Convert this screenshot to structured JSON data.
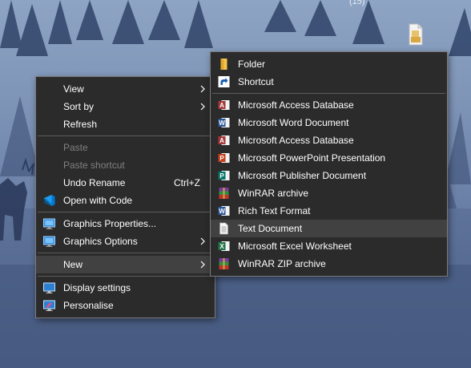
{
  "desktop": {
    "corner_count": "(15)"
  },
  "context_menu": {
    "view": "View",
    "sort_by": "Sort by",
    "refresh": "Refresh",
    "paste": "Paste",
    "paste_shortcut": "Paste shortcut",
    "undo_rename": "Undo Rename",
    "undo_shortcut": "Ctrl+Z",
    "open_with_code": "Open with Code",
    "graphics_properties": "Graphics Properties...",
    "graphics_options": "Graphics Options",
    "new": "New",
    "display_settings": "Display settings",
    "personalise": "Personalise"
  },
  "new_submenu": {
    "items": [
      {
        "label": "Folder",
        "icon": "folder-icon"
      },
      {
        "label": "Shortcut",
        "icon": "shortcut-icon"
      },
      {
        "label": "Microsoft Access Database",
        "icon": "access-icon"
      },
      {
        "label": "Microsoft Word Document",
        "icon": "word-icon"
      },
      {
        "label": "Microsoft Access Database",
        "icon": "access-icon"
      },
      {
        "label": "Microsoft PowerPoint Presentation",
        "icon": "powerpoint-icon"
      },
      {
        "label": "Microsoft Publisher Document",
        "icon": "publisher-icon"
      },
      {
        "label": "WinRAR archive",
        "icon": "winrar-icon"
      },
      {
        "label": "Rich Text Format",
        "icon": "word-icon"
      },
      {
        "label": "Text Document",
        "icon": "text-document-icon"
      },
      {
        "label": "Microsoft Excel Worksheet",
        "icon": "excel-icon"
      },
      {
        "label": "WinRAR ZIP archive",
        "icon": "winrar-zip-icon"
      }
    ]
  },
  "colors": {
    "menu_bg": "#2b2b2b",
    "highlight": "#414141",
    "disabled_text": "#808080",
    "access_red": "#a4373a",
    "word_blue": "#2b579a",
    "powerpoint_orange": "#c43e1c",
    "publisher_teal": "#077568",
    "excel_green": "#217346",
    "vscode_blue": "#0078d4"
  }
}
